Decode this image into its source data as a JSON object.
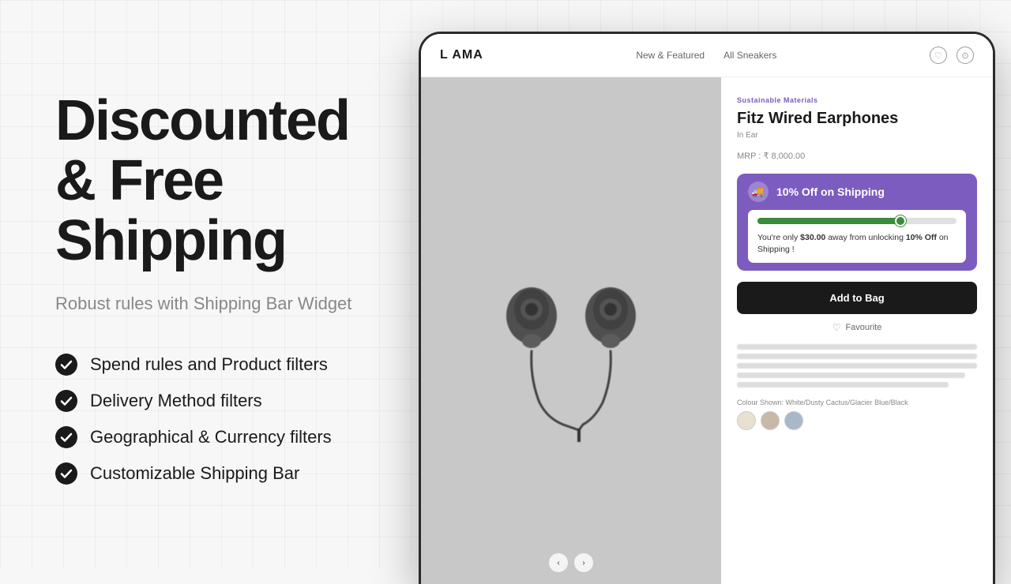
{
  "left": {
    "heading_line1": "Discounted",
    "heading_line2": "& Free",
    "heading_line3": "Shipping",
    "subheading": "Robust rules with Shipping Bar Widget",
    "features": [
      {
        "id": "feature-1",
        "text": "Spend rules and Product filters"
      },
      {
        "id": "feature-2",
        "text": "Delivery Method filters"
      },
      {
        "id": "feature-3",
        "text": "Geographical & Currency filters"
      },
      {
        "id": "feature-4",
        "text": "Customizable Shipping Bar"
      }
    ]
  },
  "device": {
    "nav": {
      "logo": "L AMA",
      "links": [
        "New & Featured",
        "All Sneakers"
      ],
      "icons": [
        "♡",
        "⊙"
      ]
    },
    "product": {
      "tag": "Sustainable Materials",
      "name": "Fitz Wired Earphones",
      "subtitle": "In Ear",
      "price": "MRP : ₹ 8,000.00",
      "widget": {
        "title": "10% Off on Shipping",
        "message_pre": "You're only ",
        "amount": "$30.00",
        "message_post": " away from unlocking ",
        "discount": "10% Off",
        "message_end": " on Shipping !"
      },
      "add_to_bag": "Add to Bag",
      "favourite": "Favourite",
      "colour_label": "Colour Shown: White/Dusty Cactus/Glacier Blue/Black",
      "progress_percent": 72
    }
  },
  "colors": {
    "purple": "#7c5cbf",
    "green": "#3a8c3a",
    "dark": "#1a1a1a",
    "text_gray": "#888888"
  },
  "swatches": [
    "#e8e0d0",
    "#c8b8a8",
    "#a8b8c8"
  ]
}
